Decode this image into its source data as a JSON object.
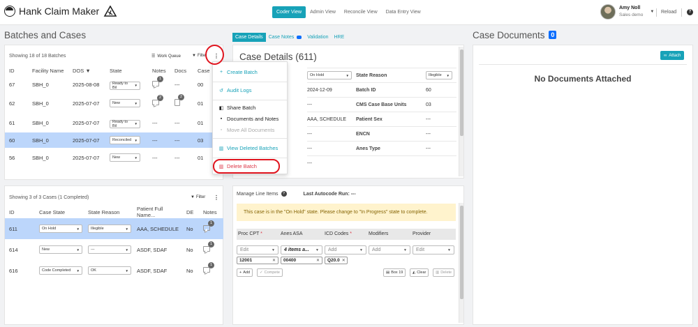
{
  "app": {
    "title": "Hank Claim Maker"
  },
  "nav": {
    "coder_view": "Coder View",
    "admin_view": "Admin View",
    "reconcile_view": "Reconcile View",
    "data_entry_view": "Data Entry View"
  },
  "user": {
    "name": "Amy Noll",
    "role": "Sales demo",
    "reload": "Reload",
    "help": "?"
  },
  "batches": {
    "title": "Batches and Cases",
    "showing": "Showing 18 of 18 Batches",
    "work_queue": "Work Queue",
    "filter": "Filter",
    "columns": [
      "ID",
      "Facility Name",
      "DOS",
      "State",
      "Notes",
      "Docs",
      "Case"
    ],
    "rows": [
      {
        "id": "67",
        "facility": "SBH_0",
        "dos": "2025-08-08",
        "state": "Ready to Bil",
        "notes": "1",
        "docs": "---",
        "case": "00"
      },
      {
        "id": "62",
        "facility": "SBH_0",
        "dos": "2025-07-07",
        "state": "New",
        "notes": "2",
        "docs": "2",
        "case": "01"
      },
      {
        "id": "61",
        "facility": "SBH_0",
        "dos": "2025-07-07",
        "state": "Ready to Bil",
        "notes": "---",
        "docs": "---",
        "case": "01"
      },
      {
        "id": "60",
        "facility": "SBH_0",
        "dos": "2025-07-07",
        "state": "Reconciled",
        "notes": "---",
        "docs": "---",
        "case": "03"
      },
      {
        "id": "56",
        "facility": "SBH_0",
        "dos": "2025-07-07",
        "state": "New",
        "notes": "---",
        "docs": "---",
        "case": "01"
      }
    ]
  },
  "menu": {
    "create_batch": "Create Batch",
    "audit_logs": "Audit Logs",
    "share_batch": "Share Batch",
    "documents_and_notes": "Documents and Notes",
    "move_all_documents": "Move All Documents",
    "view_deleted_batches": "View Deleted Batches",
    "delete_batch": "Delete Batch"
  },
  "cases": {
    "showing": "Showing 3 of 3 Cases (1 Completed)",
    "filter": "Filter",
    "columns": [
      "ID",
      "Case State",
      "State Reason",
      "Patient Full Name...",
      "DE",
      "Notes"
    ],
    "rows": [
      {
        "id": "611",
        "state": "On Hold",
        "reason": "Illegible",
        "patient": "AAA, SCHEDULE",
        "de": "No",
        "notes": "1"
      },
      {
        "id": "614",
        "state": "New",
        "reason": "---",
        "patient": "ASDF, SDAF",
        "de": "No",
        "notes": "1"
      },
      {
        "id": "616",
        "state": "Code Completed",
        "reason": "OK",
        "patient": "ASDF, SDAF",
        "de": "No",
        "notes": "1"
      }
    ]
  },
  "case_details": {
    "tabs": {
      "details": "Case Details",
      "notes": "Case Notes",
      "validation": "Validation",
      "hre": "HRE"
    },
    "title": "Case Details (611)",
    "rows": [
      {
        "value": "On Hold",
        "label": "State Reason",
        "value2": "Illegible"
      },
      {
        "value": "2024-12-09",
        "label": "Batch ID",
        "value2": "60"
      },
      {
        "value": "---",
        "label": "CMS Case Base Units",
        "value2": "03"
      },
      {
        "value": "AAA, SCHEDULE",
        "label": "Patient Sex",
        "value2": "---"
      },
      {
        "value": "---",
        "label": "ENCN",
        "value2": "---"
      },
      {
        "value": "---",
        "label": "Anes Type",
        "value2": "---"
      },
      {
        "value": "---",
        "label": "",
        "value2": ""
      }
    ]
  },
  "line_items": {
    "title": "Manage Line Items",
    "last_autocode": "Last Autocode Run: ---",
    "warning": "This case is in the \"On Hold\" state. Please change to \"In Progress\" state to complete.",
    "columns": {
      "proc": "Proc CPT",
      "anes": "Anes ASA",
      "icd": "ICD Codes",
      "modifiers": "Modifiers",
      "provider": "Provider"
    },
    "selects": {
      "proc": "Edit",
      "anes": "4 items a...",
      "icd": "Add",
      "modifiers": "Add",
      "provider": "Edit"
    },
    "chips": {
      "proc": "12001",
      "anes": "00400",
      "icd": "Q20.0"
    },
    "buttons": {
      "add": "Add",
      "complete": "Compete",
      "box19": "Box 19",
      "clear": "Clear",
      "delete": "Delete"
    }
  },
  "documents": {
    "title": "Case Documents",
    "count": "0",
    "attach": "Attach",
    "empty": "No Documents Attached"
  },
  "colors": {
    "accent": "#17a2b8",
    "badge": "#0d6efd",
    "selected_row": "#bcd6fb",
    "danger": "#dc3545",
    "annotation": "#e0141e",
    "warning_bg": "#fff3cd"
  }
}
